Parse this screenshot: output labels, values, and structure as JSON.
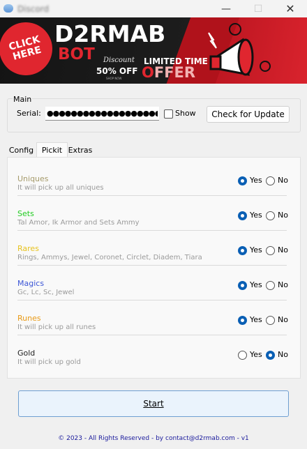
{
  "window": {
    "title": "Discord",
    "controls": {
      "minimize": "—",
      "maximize": "☐",
      "close": "✕"
    }
  },
  "banner": {
    "badge": "CLICK HERE",
    "brand": "D2RMAB",
    "bot": "BOT",
    "discount": "Discount",
    "off": "50% OFF",
    "shop": "SHOP NOW",
    "limited": "LIMITED TIME",
    "offer_o": "O",
    "offer_rest": "FFER"
  },
  "main": {
    "group_label": "Main",
    "serial_label": "Serial:",
    "serial_value": "●●●●●●●●●●●●●●●●●●●●●●",
    "show_label": "Show",
    "show_checked": false,
    "update_button": "Check for Update"
  },
  "tabs": [
    {
      "label": "Config",
      "active": false
    },
    {
      "label": "Pickit",
      "active": true
    },
    {
      "label": "Extras",
      "active": false
    }
  ],
  "options": {
    "yes": "Yes",
    "no": "No"
  },
  "pickit": [
    {
      "name": "Uniques",
      "desc": "It will pick up all uniques",
      "color": "#a59a6a",
      "selected": "yes"
    },
    {
      "name": "Sets",
      "desc": "Tal Amor, Ik Armor and Sets Ammy",
      "color": "#22cc22",
      "selected": "yes"
    },
    {
      "name": "Rares",
      "desc": "Rings, Ammys, Jewel, Coronet, Circlet, Diadem, Tiara",
      "color": "#e7c21d",
      "selected": "yes"
    },
    {
      "name": "Magics",
      "desc": "Gc, Lc, Sc, Jewel",
      "color": "#3b55d6",
      "selected": "yes"
    },
    {
      "name": "Runes",
      "desc": "It will pick up all runes",
      "color": "#e99a16",
      "selected": "yes"
    },
    {
      "name": "Gold",
      "desc": "It will pick up gold",
      "color": "#222222",
      "selected": "no"
    }
  ],
  "start_button": "Start",
  "footer": "© 2023 - All Rights Reserved - by contact@d2rmab.com - v1"
}
